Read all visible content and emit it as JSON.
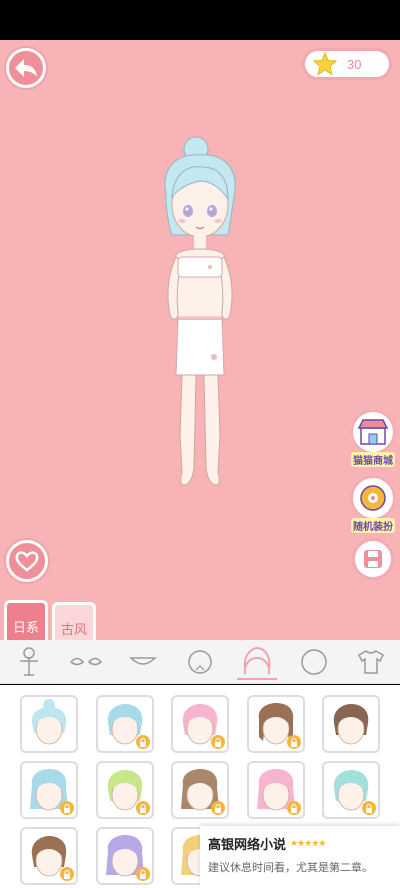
{
  "coins": {
    "count": "30"
  },
  "side_buttons": {
    "shop_label": "猫猫商城",
    "shop_sign": "SHOP",
    "random_label": "随机装扮"
  },
  "style_tabs": {
    "active": "日系",
    "inactive": "古风"
  },
  "categories": [
    {
      "icon": "body-icon"
    },
    {
      "icon": "eyes-icon"
    },
    {
      "icon": "mouth-icon"
    },
    {
      "icon": "face-icon"
    },
    {
      "icon": "hair-icon",
      "selected": true
    },
    {
      "icon": "head-icon"
    },
    {
      "icon": "shirt-icon"
    }
  ],
  "hair_items": [
    {
      "hair": "#bfe6ef",
      "style": "bun",
      "locked": false
    },
    {
      "hair": "#a8dbea",
      "style": "short",
      "locked": true
    },
    {
      "hair": "#f6b4cf",
      "style": "short",
      "locked": true
    },
    {
      "hair": "#9a7155",
      "style": "twin",
      "locked": true
    },
    {
      "hair": "#8a6551",
      "style": "short",
      "locked": false
    },
    {
      "hair": "#a8dbea",
      "style": "long",
      "locked": true
    },
    {
      "hair": "#c8e68a",
      "style": "bob",
      "locked": true
    },
    {
      "hair": "#a9876a",
      "style": "long",
      "locked": true
    },
    {
      "hair": "#f6b4cf",
      "style": "long",
      "locked": true
    },
    {
      "hair": "#a3dfdd",
      "style": "bob",
      "locked": true
    },
    {
      "hair": "#9a7155",
      "style": "bob",
      "locked": true
    },
    {
      "hair": "#b8a8e8",
      "style": "long",
      "locked": true
    },
    {
      "hair": "#f2cf7a",
      "style": "long",
      "locked": true
    }
  ],
  "ad": {
    "title": "高银网络小说",
    "stars": "★★★★★",
    "description": "建议休息时间看，尤其是第二章。"
  },
  "colors": {
    "stage_bg": "#f7b3b6",
    "accent": "#ee8f99",
    "lock": "#f5b73b"
  }
}
